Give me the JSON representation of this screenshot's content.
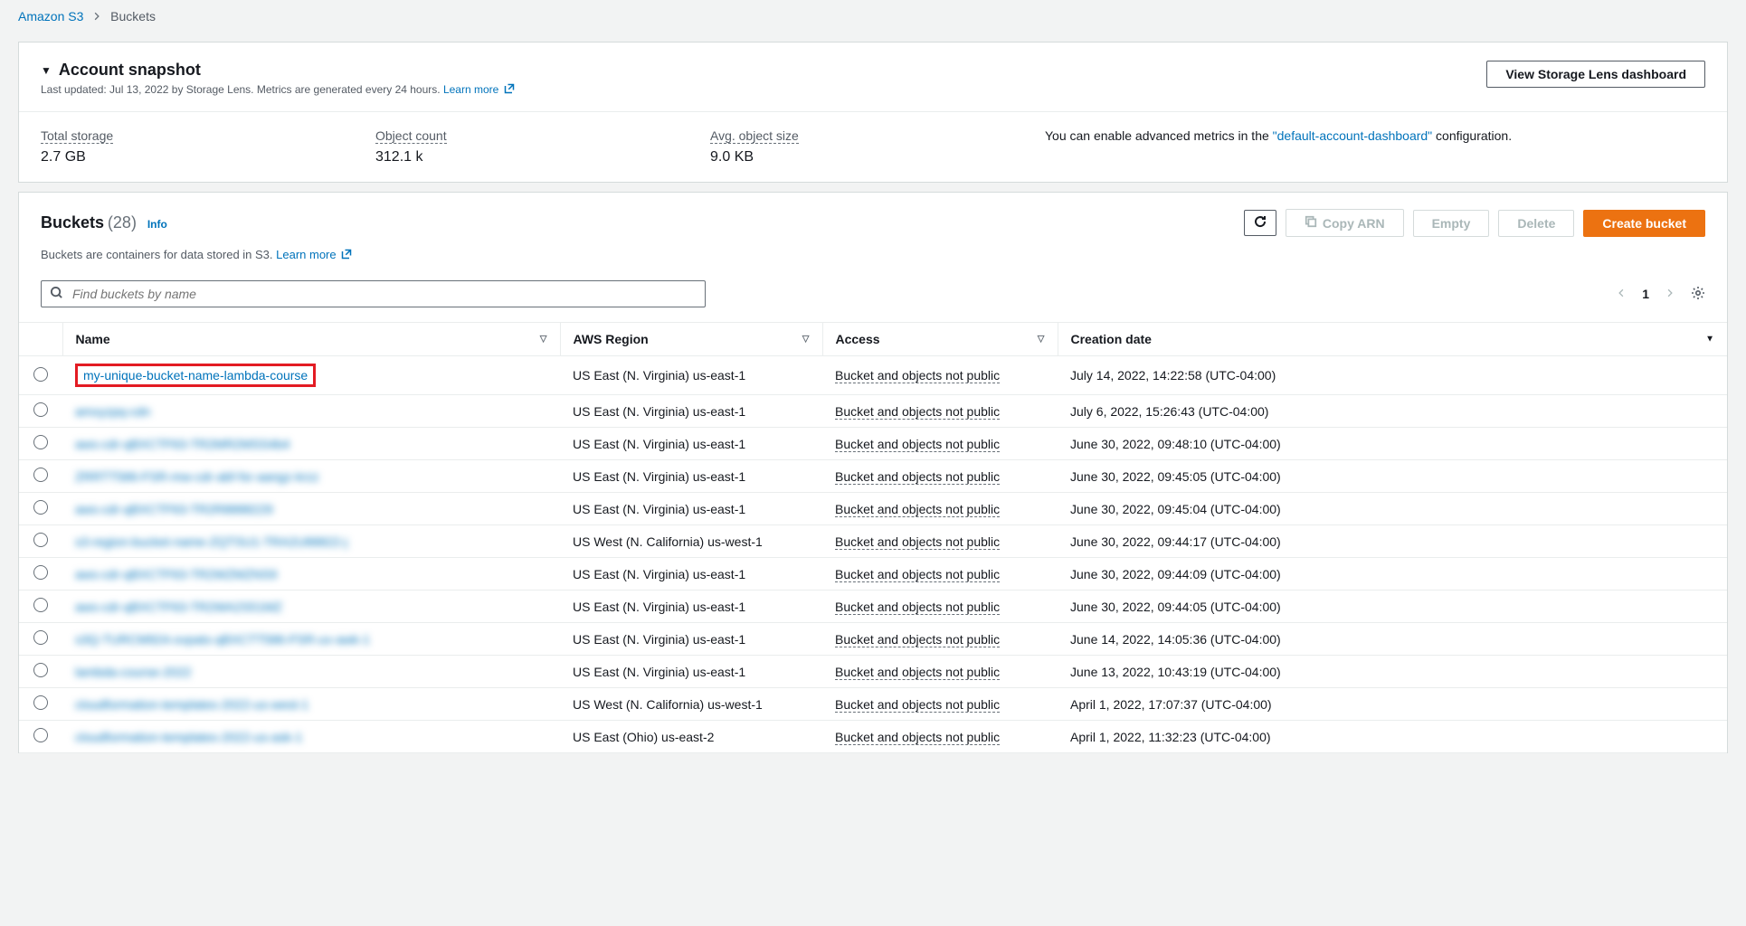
{
  "breadcrumb": {
    "root": "Amazon S3",
    "current": "Buckets"
  },
  "snapshot": {
    "title": "Account snapshot",
    "subtitle_prefix": "Last updated: Jul 13, 2022 by Storage Lens. Metrics are generated every 24 hours. ",
    "learn_more": "Learn more",
    "view_dashboard": "View Storage Lens dashboard",
    "stats": {
      "total_storage_label": "Total storage",
      "total_storage_value": "2.7 GB",
      "object_count_label": "Object count",
      "object_count_value": "312.1 k",
      "avg_size_label": "Avg. object size",
      "avg_size_value": "9.0 KB"
    },
    "note_prefix": "You can enable advanced metrics in the ",
    "note_link": "\"default-account-dashboard\"",
    "note_suffix": " configuration."
  },
  "buckets": {
    "title": "Buckets",
    "count": "(28)",
    "info": "Info",
    "subtitle": "Buckets are containers for data stored in S3. ",
    "learn_more": "Learn more",
    "actions": {
      "copy_arn": "Copy ARN",
      "empty": "Empty",
      "delete": "Delete",
      "create": "Create bucket"
    },
    "search_placeholder": "Find buckets by name",
    "page": "1",
    "columns": {
      "name": "Name",
      "region": "AWS Region",
      "access": "Access",
      "creation": "Creation date"
    },
    "rows": [
      {
        "name": "my-unique-bucket-name-lambda-course",
        "region": "US East (N. Virginia) us-east-1",
        "access": "Bucket and objects not public",
        "creation": "July 14, 2022, 14:22:58 (UTC-04:00)",
        "highlighted": true
      },
      {
        "name": "amxyzpq-cdn",
        "region": "US East (N. Virginia) us-east-1",
        "access": "Bucket and objects not public",
        "creation": "July 6, 2022, 15:26:43 (UTC-04:00)",
        "blurred": true
      },
      {
        "name": "aws-cdr-qBXCTF63-TR2MR2MSS4b4",
        "region": "US East (N. Virginia) us-east-1",
        "access": "Bucket and objects not public",
        "creation": "June 30, 2022, 09:48:10 (UTC-04:00)",
        "blurred": true
      },
      {
        "name": "ZRRTT586-FSR-mw-cdr-abf-fsr-aangz-krzz",
        "region": "US East (N. Virginia) us-east-1",
        "access": "Bucket and objects not public",
        "creation": "June 30, 2022, 09:45:05 (UTC-04:00)",
        "blurred": true
      },
      {
        "name": "aws-cdr-qBXCTF63-TR2R8888229",
        "region": "US East (N. Virginia) us-east-1",
        "access": "Bucket and objects not public",
        "creation": "June 30, 2022, 09:45:04 (UTC-04:00)",
        "blurred": true
      },
      {
        "name": "s3-region-bucket-name-ZQTSU1-TRA2U88822-j",
        "region": "US West (N. California) us-west-1",
        "access": "Bucket and objects not public",
        "creation": "June 30, 2022, 09:44:17 (UTC-04:00)",
        "blurred": true
      },
      {
        "name": "aws-cdr-qBXCTF63-TR2WZMZNS9",
        "region": "US East (N. Virginia) us-east-1",
        "access": "Bucket and objects not public",
        "creation": "June 30, 2022, 09:44:09 (UTC-04:00)",
        "blurred": true
      },
      {
        "name": "aws-cdr-qBXCTF63-TR2WA2S51MZ",
        "region": "US East (N. Virginia) us-east-1",
        "access": "Bucket and objects not public",
        "creation": "June 30, 2022, 09:44:05 (UTC-04:00)",
        "blurred": true
      },
      {
        "name": "s3Q-TURCM924-ovpats-qBXCTT586-FSR-uv-awk-1",
        "region": "US East (N. Virginia) us-east-1",
        "access": "Bucket and objects not public",
        "creation": "June 14, 2022, 14:05:36 (UTC-04:00)",
        "blurred": true
      },
      {
        "name": "lambda-course-2022",
        "region": "US East (N. Virginia) us-east-1",
        "access": "Bucket and objects not public",
        "creation": "June 13, 2022, 10:43:19 (UTC-04:00)",
        "blurred": true
      },
      {
        "name": "cloudformation-templates-2022-us-west-1",
        "region": "US West (N. California) us-west-1",
        "access": "Bucket and objects not public",
        "creation": "April 1, 2022, 17:07:37 (UTC-04:00)",
        "blurred": true
      },
      {
        "name": "cloudformation-templates-2022-us-ask-1",
        "region": "US East (Ohio) us-east-2",
        "access": "Bucket and objects not public",
        "creation": "April 1, 2022, 11:32:23 (UTC-04:00)",
        "blurred": true
      }
    ]
  }
}
